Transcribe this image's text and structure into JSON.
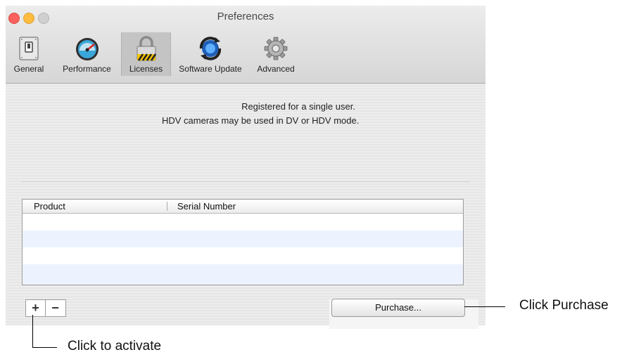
{
  "window": {
    "title": "Preferences"
  },
  "toolbar": {
    "items": [
      {
        "label": "General",
        "icon": "switch-icon"
      },
      {
        "label": "Performance",
        "icon": "speedometer-icon"
      },
      {
        "label": "Licenses",
        "icon": "padlock-icon",
        "selected": true
      },
      {
        "label": "Software Update",
        "icon": "sync-icon"
      },
      {
        "label": "Advanced",
        "icon": "gear-icon"
      }
    ]
  },
  "licenses": {
    "message_line1": "Registered for a single user.",
    "message_line2": "HDV cameras may be used in DV or HDV mode.",
    "table": {
      "columns": [
        "Product",
        "Serial Number"
      ],
      "rows": []
    },
    "add_label": "+",
    "remove_label": "−",
    "purchase_label": "Purchase..."
  },
  "callouts": {
    "purchase": "Click Purchase",
    "activate": "Click to activate"
  },
  "colors": {
    "close": "#fc615d",
    "minimize": "#fdbc40",
    "table_alt_row": "#edf3fe"
  }
}
